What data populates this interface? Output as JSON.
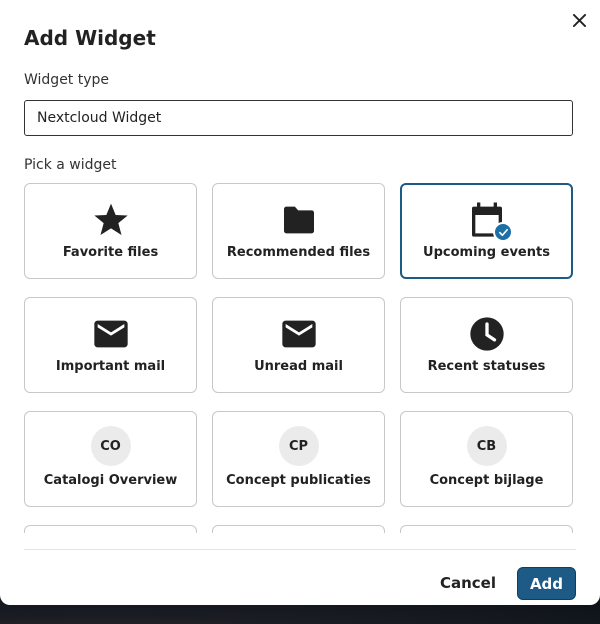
{
  "dialog": {
    "title": "Add Widget",
    "close_icon": "close-icon"
  },
  "widget_type": {
    "label": "Widget type",
    "value": "Nextcloud Widget"
  },
  "picker": {
    "label": "Pick a widget",
    "widgets": [
      {
        "name": "Favorite files",
        "icon": "star-icon",
        "selected": false
      },
      {
        "name": "Recommended files",
        "icon": "folder-icon",
        "selected": false
      },
      {
        "name": "Upcoming events",
        "icon": "calendar-icon",
        "selected": true
      },
      {
        "name": "Important mail",
        "icon": "mail-icon",
        "selected": false
      },
      {
        "name": "Unread mail",
        "icon": "mail-icon",
        "selected": false
      },
      {
        "name": "Recent statuses",
        "icon": "clock-icon",
        "selected": false
      },
      {
        "name": "Catalogi Overview",
        "initials": "CO",
        "selected": false
      },
      {
        "name": "Concept publicaties",
        "initials": "CP",
        "selected": false
      },
      {
        "name": "Concept bijlage",
        "initials": "CB",
        "selected": false
      }
    ]
  },
  "footer": {
    "cancel_label": "Cancel",
    "add_label": "Add"
  },
  "colors": {
    "primary": "#1d5a85",
    "check_badge": "#1d6fa5"
  }
}
